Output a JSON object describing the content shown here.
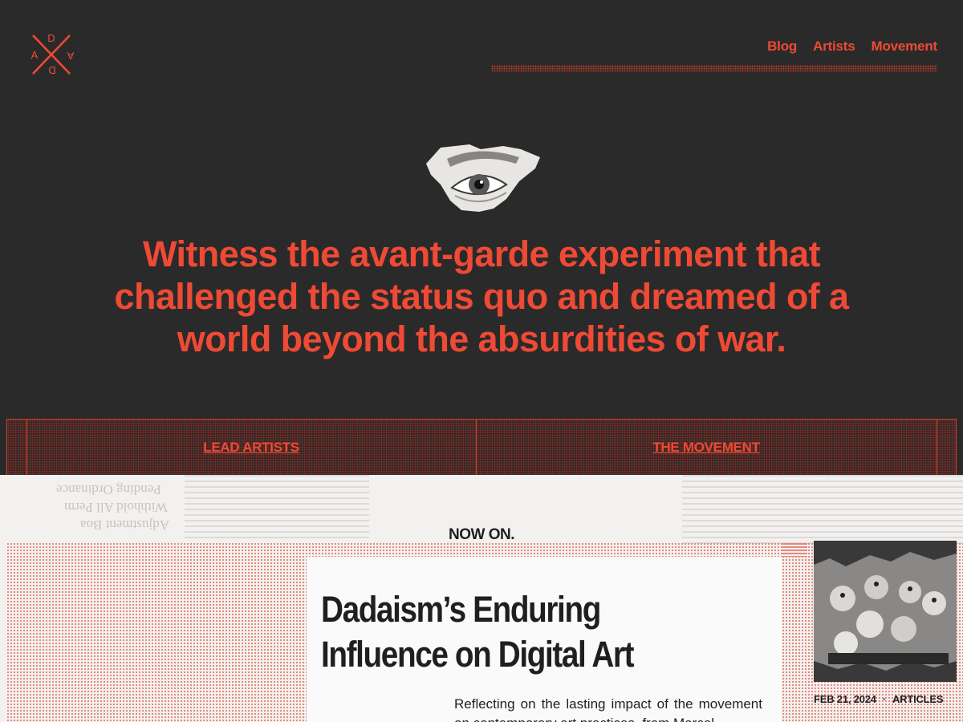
{
  "logo": {
    "letters": [
      "D",
      "A",
      "D",
      "A"
    ]
  },
  "nav": {
    "items": [
      {
        "label": "Blog"
      },
      {
        "label": "Artists"
      },
      {
        "label": "Movement"
      }
    ]
  },
  "hero": {
    "headline": "Witness the avant-garde experiment that challenged the status quo and dreamed of a world beyond the absurdities of war."
  },
  "tabs": [
    {
      "label": "LEAD ARTISTS"
    },
    {
      "label": "THE MOVEMENT"
    }
  ],
  "section": {
    "heading": "NOW ON."
  },
  "article": {
    "title": "Dadaism’s Enduring Influence on Digital Art",
    "excerpt": "Reflecting on the lasting impact of the movement on contemporary art practices, from Marcel",
    "date": "FEB 21, 2024",
    "separator": "·",
    "category": "ARTICLES"
  },
  "background_text": [
    "Pending Ordinance",
    "Withhold All Perm",
    "Adjustment Boa"
  ],
  "colors": {
    "accent": "#ee4a35",
    "dark": "#2b2a2a",
    "paper": "#f2f1ef",
    "text": "#1f1f1f"
  },
  "icons": {
    "eye": "collage-eye-cutout",
    "photo": "torn-group-photo"
  }
}
